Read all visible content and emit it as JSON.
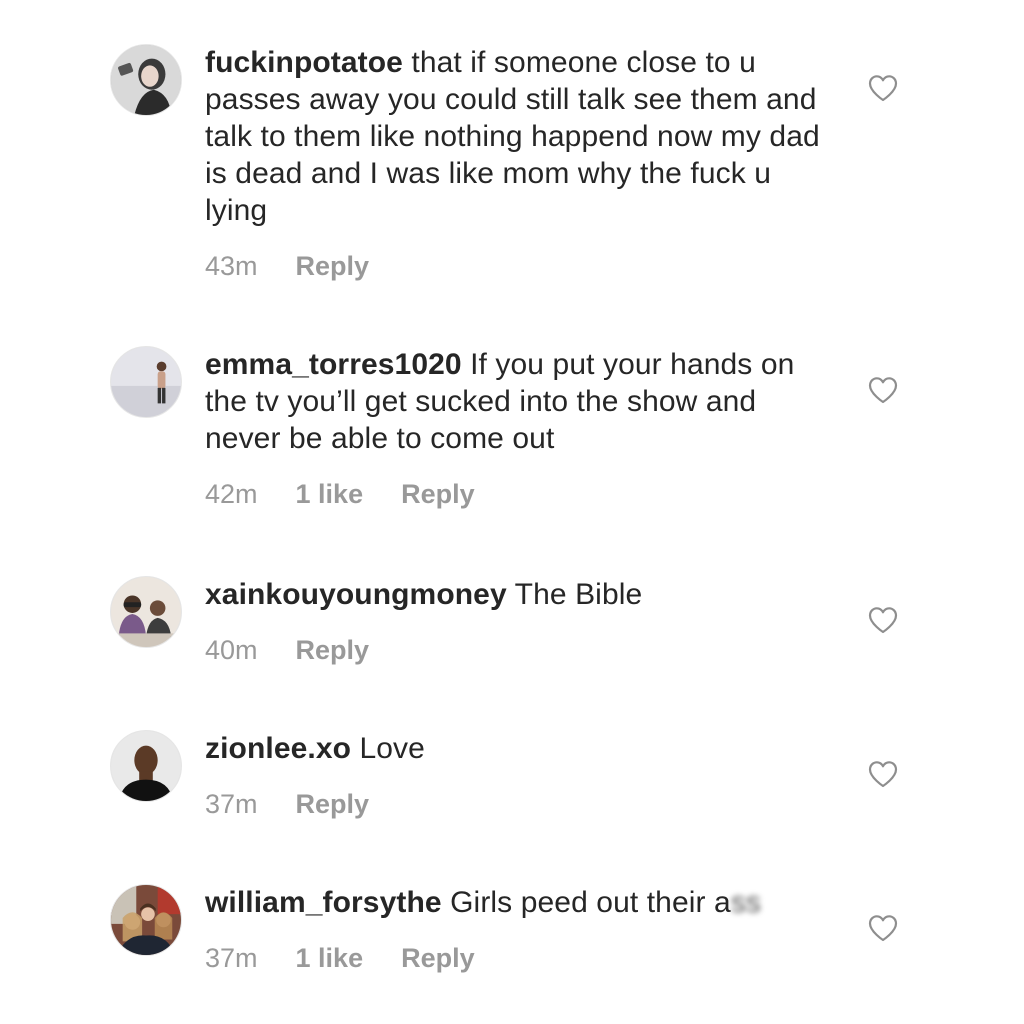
{
  "comments": [
    {
      "username": "fuckinpotatoe",
      "text": " that if someone close to u passes away you could still talk see them and talk to them like nothing happend now my dad is dead and I was like mom why the fuck u lying",
      "time": "43m",
      "likes": "",
      "reply": "Reply",
      "avatar_icon": "user-avatar"
    },
    {
      "username": "emma_torres1020",
      "text": " If you put your hands on the tv you’ll get sucked into the show and never be able to come out",
      "time": "42m",
      "likes": "1 like",
      "reply": "Reply",
      "avatar_icon": "user-avatar"
    },
    {
      "username": "xainkouyoungmoney",
      "text": " The Bible",
      "time": "40m",
      "likes": "",
      "reply": "Reply",
      "avatar_icon": "user-avatar"
    },
    {
      "username": "zionlee.xo",
      "text": " Love",
      "time": "37m",
      "likes": "",
      "reply": "Reply",
      "avatar_icon": "user-avatar"
    },
    {
      "username": "william_forsythe",
      "text": " Girls peed out their a",
      "text_blurred": "ss",
      "time": "37m",
      "likes": "1 like",
      "reply": "Reply",
      "avatar_icon": "user-avatar"
    }
  ],
  "colors": {
    "text": "#262626",
    "meta": "#999999",
    "heart_stroke": "#8e8e8e"
  }
}
